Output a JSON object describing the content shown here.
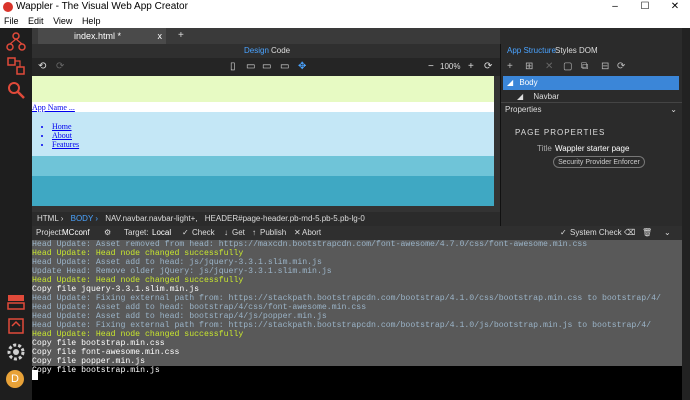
{
  "window": {
    "title": "Wappler - The Visual Web App Creator",
    "minimize": "–",
    "maximize": "☐",
    "close": "✕"
  },
  "menu": [
    "File",
    "Edit",
    "View",
    "Help"
  ],
  "editor": {
    "tab": {
      "label": "index.html *",
      "close": "x"
    },
    "tab_add": "+",
    "view_modes": {
      "design": "Design",
      "code": "Code"
    },
    "zoom": "100%"
  },
  "canvas": {
    "app_name_link": "App Name ...",
    "nav_items": [
      "Home",
      "About",
      "Features"
    ]
  },
  "breadcrumb": [
    "HTML ›",
    "BODY ›",
    "NAV.navbar.navbar-light+,",
    "HEADER#page-header.pb-md-5.pb-5.pb-lg-0"
  ],
  "right_panel": {
    "tabs": [
      "App Structure",
      "Styles",
      "DOM"
    ],
    "tree": {
      "body": "Body",
      "navbar": "Navbar"
    },
    "properties_label": "Properties",
    "page_properties_label": "PAGE PROPERTIES",
    "title_label": "Title",
    "title_value": "Wappler starter page",
    "security_button": "Security Provider Enforcer"
  },
  "output_bar": {
    "project_label": "Project:",
    "project_value": "MCconf",
    "target_label": "Target:",
    "target_value": "Local",
    "check": "Check",
    "get": "Get",
    "publish": "Publish",
    "abort": "Abort",
    "system_check": "System Check"
  },
  "terminal": [
    {
      "text": "Head Update: Asset removed from head: https://maxcdn.bootstrapcdn.com/font-awesome/4.7.0/css/font-awesome.min.css",
      "color": "#9bb4c8"
    },
    {
      "text": "Head Update: Head node changed successfully",
      "color": "#c8e62e"
    },
    {
      "text": "Head Update: Asset add to head: js/jquery-3.3.1.slim.min.js",
      "color": "#9bb4c8"
    },
    {
      "text": "Update Head: Remove older jQuery: js/jquery-3.3.1.slim.min.js",
      "color": "#9bb4c8"
    },
    {
      "text": "Head Update: Head node changed successfully",
      "color": "#c8e62e"
    },
    {
      "text": "Copy file jquery-3.3.1.slim.min.js",
      "color": "#ffffff"
    },
    {
      "text": "Head Update: Fixing external path from: https://stackpath.bootstrapcdn.com/bootstrap/4.1.0/css/bootstrap.min.css to bootstrap/4/",
      "color": "#9bb4c8"
    },
    {
      "text": "Head Update: Asset add to head: bootstrap/4/css/font-awesome.min.css",
      "color": "#9bb4c8"
    },
    {
      "text": "Head Update: Asset add to head: bootstrap/4/js/popper.min.js",
      "color": "#9bb4c8"
    },
    {
      "text": "Head Update: Fixing external path from: https://stackpath.bootstrapcdn.com/bootstrap/4.1.0/js/bootstrap.min.js to bootstrap/4/",
      "color": "#9bb4c8"
    },
    {
      "text": "Head Update: Head node changed successfully",
      "color": "#c8e62e"
    },
    {
      "text": "Copy file bootstrap.min.css",
      "color": "#ffffff"
    },
    {
      "text": "Copy file font-awesome.min.css",
      "color": "#ffffff"
    },
    {
      "text": "Copy file popper.min.js",
      "color": "#ffffff"
    },
    {
      "text": "Copy file bootstrap.min.js",
      "color": "#ffffff"
    }
  ],
  "user_badge": "D"
}
